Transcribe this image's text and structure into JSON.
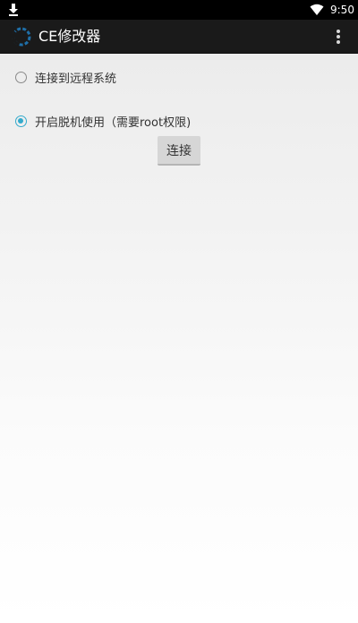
{
  "status_bar": {
    "time": "9:50",
    "icons": [
      "download-icon",
      "wifi-icon",
      "battery-icon"
    ]
  },
  "app_bar": {
    "title": "CE修改器",
    "logo_icon": "ce-logo-icon",
    "menu_icon": "overflow-menu-icon"
  },
  "options": [
    {
      "label": "连接到远程系统",
      "selected": false
    },
    {
      "label": "开启脱机使用（需要root权限)",
      "selected": true
    }
  ],
  "connect_button": {
    "label": "连接"
  },
  "colors": {
    "status_bar_bg": "#000000",
    "app_bar_bg": "#1a1a1a",
    "accent": "#33aacc",
    "button_bg": "#d6d6d6",
    "text": "#333333"
  }
}
